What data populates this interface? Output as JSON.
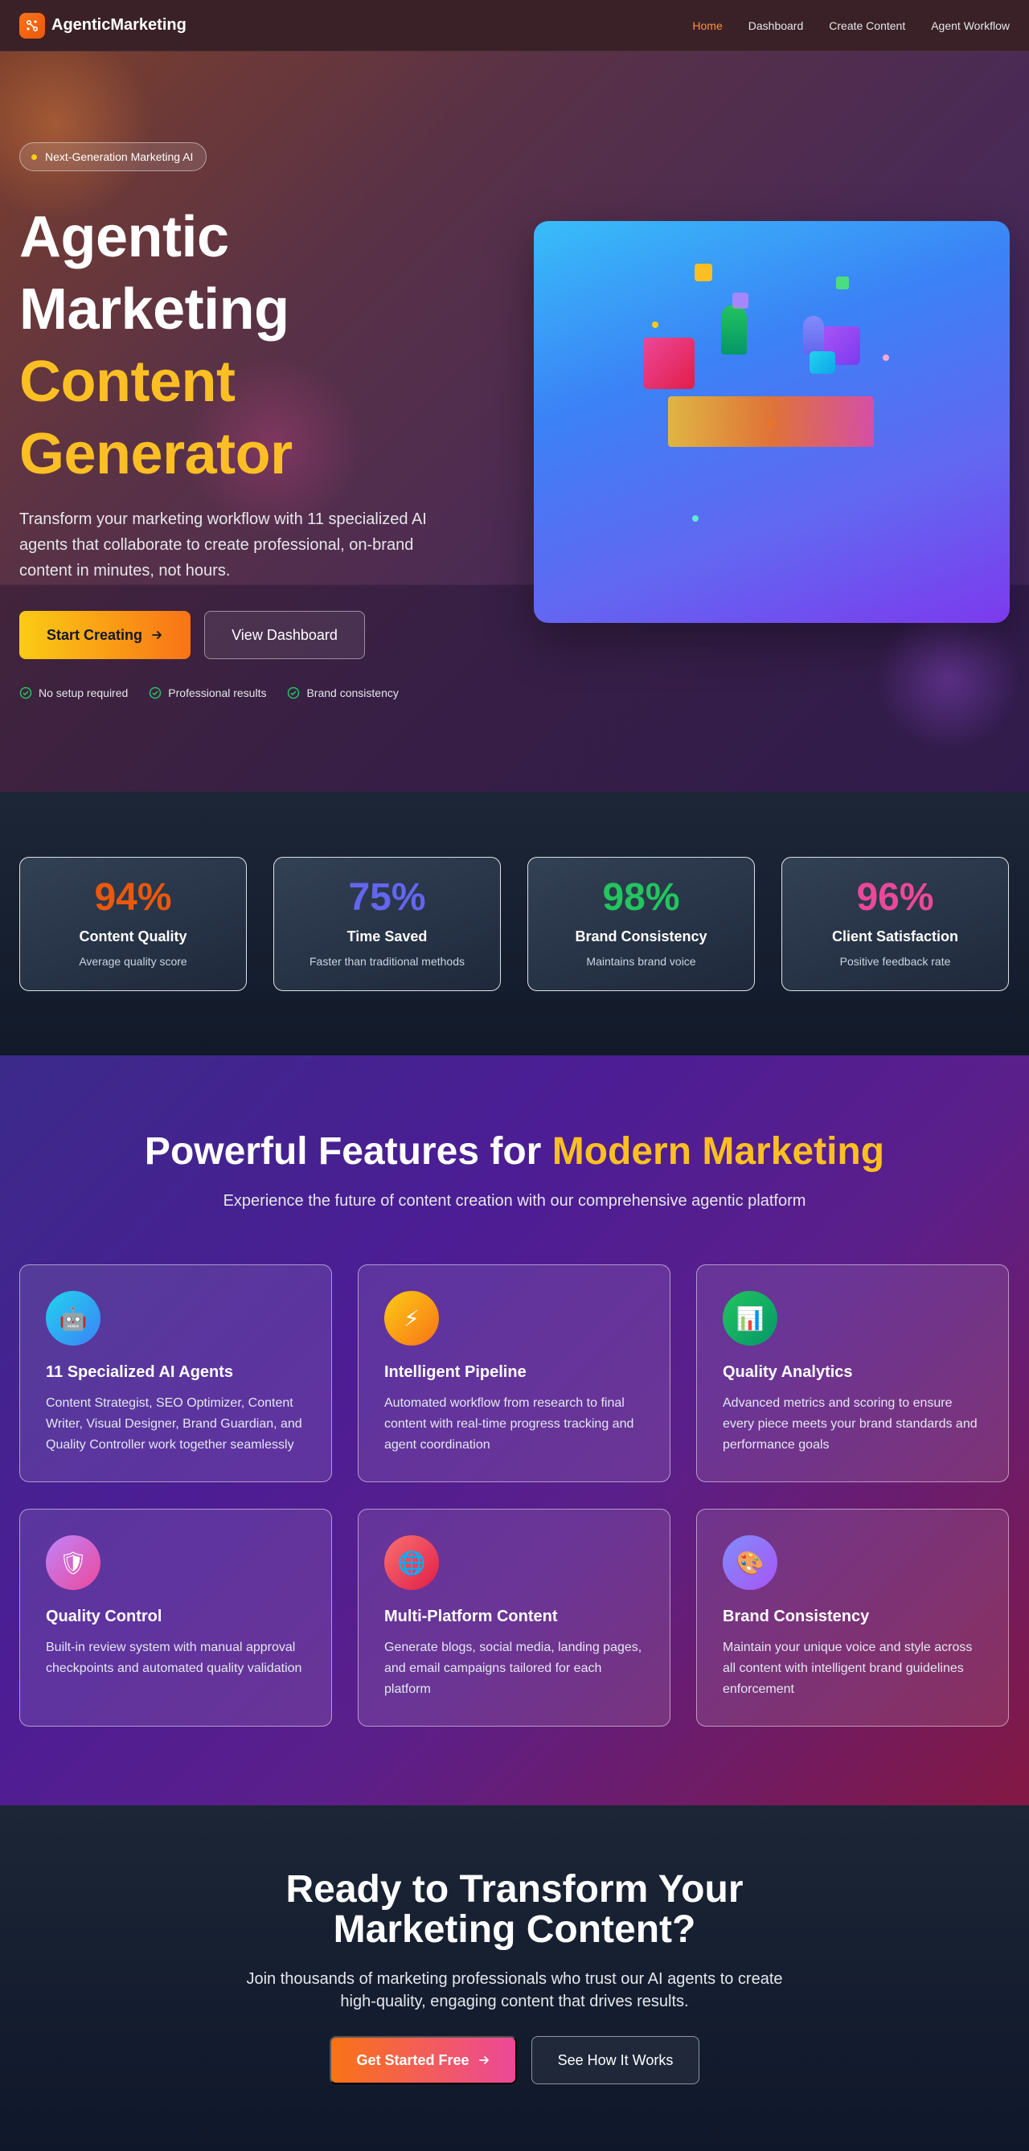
{
  "nav": {
    "brand": "AgenticMarketing",
    "links": [
      {
        "label": "Home",
        "active": true
      },
      {
        "label": "Dashboard",
        "active": false
      },
      {
        "label": "Create Content",
        "active": false
      },
      {
        "label": "Agent Workflow",
        "active": false
      }
    ]
  },
  "hero": {
    "badge": "Next-Generation Marketing AI",
    "title_lines": [
      "Agentic",
      "Marketing",
      "Content",
      "Generator"
    ],
    "description": "Transform your marketing workflow with 11 specialized AI agents that collaborate to create professional, on-brand content in minutes, not hours.",
    "primary_cta": "Start Creating",
    "secondary_cta": "View Dashboard",
    "checks": [
      "No setup required",
      "Professional results",
      "Brand consistency"
    ]
  },
  "stats": [
    {
      "value": "94%",
      "label": "Content Quality",
      "sub": "Average quality score",
      "color": "#f97316"
    },
    {
      "value": "75%",
      "label": "Time Saved",
      "sub": "Faster than traditional methods",
      "color": "#6366f1"
    },
    {
      "value": "98%",
      "label": "Brand Consistency",
      "sub": "Maintains brand voice",
      "color": "#22c55e"
    },
    {
      "value": "96%",
      "label": "Client Satisfaction",
      "sub": "Positive feedback rate",
      "color": "#ec4899"
    }
  ],
  "features": {
    "title_main": "Powerful Features for ",
    "title_accent": "Modern Marketing",
    "subtitle": "Experience the future of content creation with our comprehensive agentic platform",
    "cards": [
      {
        "icon": "robot-icon",
        "glyph": "🤖",
        "title": "11 Specialized AI Agents",
        "desc": "Content Strategist, SEO Optimizer, Content Writer, Visual Designer, Brand Guardian, and Quality Controller work together seamlessly"
      },
      {
        "icon": "lightning-icon",
        "glyph": "⚡",
        "title": "Intelligent Pipeline",
        "desc": "Automated workflow from research to final content with real-time progress tracking and agent coordination"
      },
      {
        "icon": "chart-icon",
        "glyph": "📊",
        "title": "Quality Analytics",
        "desc": "Advanced metrics and scoring to ensure every piece meets your brand standards and performance goals"
      },
      {
        "icon": "shield-icon",
        "glyph": "🛡",
        "title": "Quality Control",
        "desc": "Built-in review system with manual approval checkpoints and automated quality validation"
      },
      {
        "icon": "globe-icon",
        "glyph": "🌐",
        "title": "Multi-Platform Content",
        "desc": "Generate blogs, social media, landing pages, and email campaigns tailored for each platform"
      },
      {
        "icon": "palette-icon",
        "glyph": "🎨",
        "title": "Brand Consistency",
        "desc": "Maintain your unique voice and style across all content with intelligent brand guidelines enforcement"
      }
    ]
  },
  "cta": {
    "title": "Ready to Transform Your Marketing Content?",
    "subtitle": "Join thousands of marketing professionals who trust our AI agents to create high-quality, engaging content that drives results.",
    "primary": "Get Started Free",
    "secondary": "See How It Works"
  },
  "colors": {
    "accent_orange": "#f97316",
    "accent_yellow": "#fbbf24",
    "success_green": "#22c55e"
  }
}
